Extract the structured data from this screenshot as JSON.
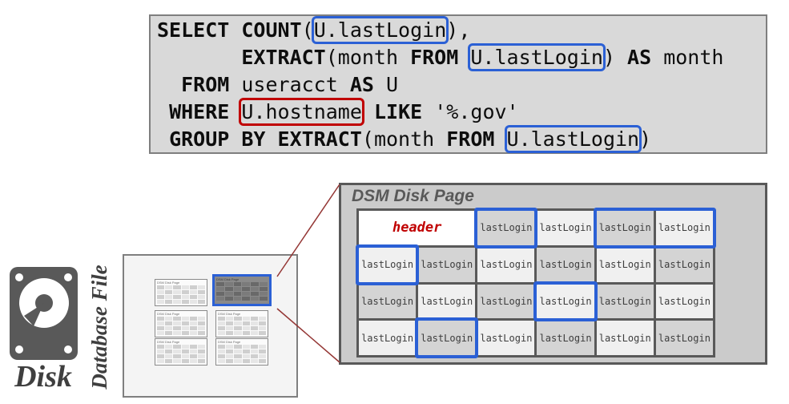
{
  "colors": {
    "blue": "#2b60d5",
    "red": "#c00000",
    "connector": "#943634",
    "sql_bg": "#d9d9d9",
    "dsm_bg": "#cbcbcb",
    "cell_dark": "#d4d4d4",
    "cell_light": "#f0f0f0",
    "border_dark": "#595959",
    "text_dark": "#3f3f3f"
  },
  "sql": {
    "lines": [
      {
        "segments": [
          {
            "t": "SELECT COUNT",
            "k": true
          },
          {
            "t": "(",
            "k": false
          },
          {
            "t": "U.lastLogin",
            "k": false,
            "hl": "blue"
          },
          {
            "t": "),",
            "k": false
          }
        ]
      },
      {
        "segments": [
          {
            "t": "       ",
            "k": false
          },
          {
            "t": "EXTRACT",
            "k": true
          },
          {
            "t": "(month ",
            "k": false
          },
          {
            "t": "FROM",
            "k": true
          },
          {
            "t": " ",
            "k": false
          },
          {
            "t": "U.lastLogin",
            "k": false,
            "hl": "blue"
          },
          {
            "t": ") ",
            "k": false
          },
          {
            "t": "AS",
            "k": true
          },
          {
            "t": " month",
            "k": false
          }
        ]
      },
      {
        "segments": [
          {
            "t": "  ",
            "k": false
          },
          {
            "t": "FROM",
            "k": true
          },
          {
            "t": " useracct ",
            "k": false
          },
          {
            "t": "AS",
            "k": true
          },
          {
            "t": " U",
            "k": false
          }
        ]
      },
      {
        "segments": [
          {
            "t": " ",
            "k": false
          },
          {
            "t": "WHERE",
            "k": true
          },
          {
            "t": " ",
            "k": false
          },
          {
            "t": "U.hostname",
            "k": false,
            "hl": "red"
          },
          {
            "t": " ",
            "k": false
          },
          {
            "t": "LIKE",
            "k": true
          },
          {
            "t": " '%.gov'",
            "k": false
          }
        ]
      },
      {
        "segments": [
          {
            "t": " ",
            "k": false
          },
          {
            "t": "GROUP BY EXTRACT",
            "k": true
          },
          {
            "t": "(month ",
            "k": false
          },
          {
            "t": "FROM",
            "k": true
          },
          {
            "t": " ",
            "k": false
          },
          {
            "t": "U.lastLogin",
            "k": false,
            "hl": "blue"
          },
          {
            "t": ")",
            "k": false
          }
        ]
      }
    ]
  },
  "dsm": {
    "title": "DSM Disk Page",
    "rows": [
      {
        "cells": [
          {
            "type": "header",
            "label": "header",
            "span": 2
          },
          {
            "label": "lastLogin",
            "shade": "dark",
            "hl": "solo"
          },
          {
            "label": "lastLogin",
            "shade": "light"
          },
          {
            "label": "lastLogin",
            "shade": "dark",
            "hl": "group"
          },
          {
            "label": "lastLogin",
            "shade": "light",
            "hl": "group"
          }
        ]
      },
      {
        "cells": [
          {
            "label": "lastLogin",
            "shade": "light",
            "hl": "solo"
          },
          {
            "label": "lastLogin",
            "shade": "dark"
          },
          {
            "label": "lastLogin",
            "shade": "light"
          },
          {
            "label": "lastLogin",
            "shade": "dark"
          },
          {
            "label": "lastLogin",
            "shade": "light"
          },
          {
            "label": "lastLogin",
            "shade": "dark"
          }
        ]
      },
      {
        "cells": [
          {
            "label": "lastLogin",
            "shade": "dark"
          },
          {
            "label": "lastLogin",
            "shade": "light"
          },
          {
            "label": "lastLogin",
            "shade": "dark"
          },
          {
            "label": "lastLogin",
            "shade": "light",
            "hl": "solo"
          },
          {
            "label": "lastLogin",
            "shade": "dark"
          },
          {
            "label": "lastLogin",
            "shade": "light"
          }
        ]
      },
      {
        "cells": [
          {
            "label": "lastLogin",
            "shade": "light"
          },
          {
            "label": "lastLogin",
            "shade": "dark",
            "hl": "solo"
          },
          {
            "label": "lastLogin",
            "shade": "light"
          },
          {
            "label": "lastLogin",
            "shade": "dark"
          },
          {
            "label": "lastLogin",
            "shade": "light"
          },
          {
            "label": "lastLogin",
            "shade": "dark"
          }
        ]
      }
    ]
  },
  "database_file": {
    "label": "Database File",
    "page_label": "DSM Disk Page",
    "pages": [
      {
        "selected": false
      },
      {
        "selected": true
      },
      {
        "selected": false
      },
      {
        "selected": false
      },
      {
        "selected": false
      },
      {
        "selected": false
      }
    ]
  },
  "disk": {
    "label": "Disk"
  }
}
